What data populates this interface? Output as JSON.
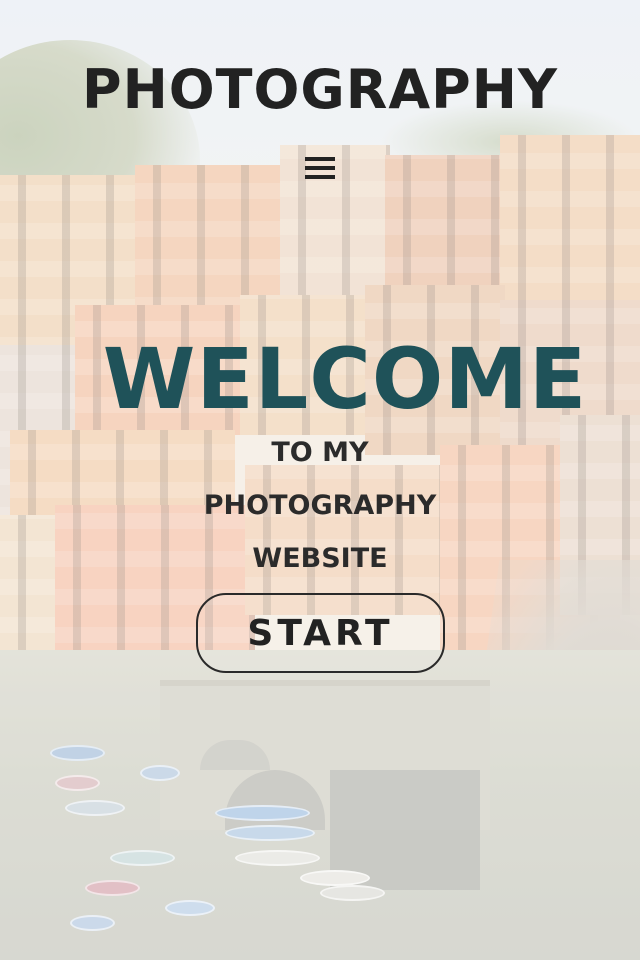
{
  "header": {
    "brand": "PHOTOGRAPHY",
    "menu_icon": "hamburger-menu-icon"
  },
  "hero": {
    "title": "WELCOME",
    "subtitle_lines": [
      "TO MY",
      "PHOTOGRAPHY",
      "WEBSITE"
    ],
    "cta_label": "START"
  },
  "colors": {
    "title": "#1f5259",
    "text": "#222222",
    "background_tint": "#f3eadf"
  }
}
